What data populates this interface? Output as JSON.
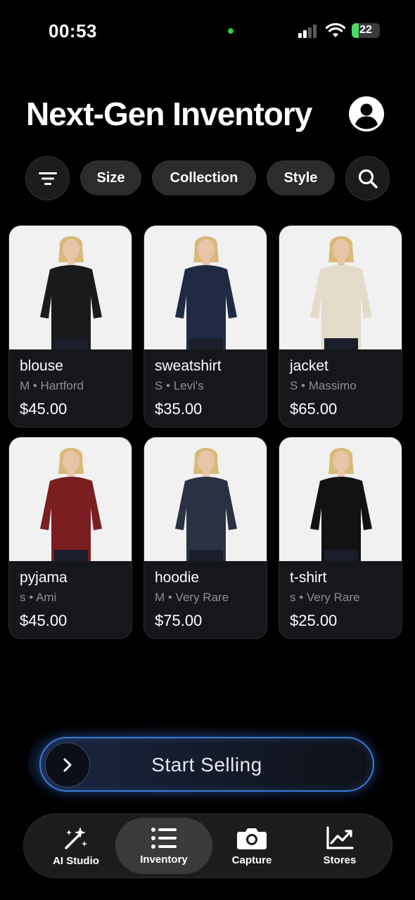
{
  "status": {
    "time": "00:53",
    "battery": "22"
  },
  "header": {
    "title": "Next-Gen Inventory"
  },
  "filters": [
    "Size",
    "Collection",
    "Style"
  ],
  "products": [
    {
      "name": "blouse",
      "meta": "M • Hartford",
      "price": "$45.00",
      "color": "#1a1a1a"
    },
    {
      "name": "sweatshirt",
      "meta": "S • Levi's",
      "price": "$35.00",
      "color": "#1f2a44"
    },
    {
      "name": "jacket",
      "meta": "S • Massimo",
      "price": "$65.00",
      "color": "#e3dccb"
    },
    {
      "name": "pyjama",
      "meta": "s • Ami",
      "price": "$45.00",
      "color": "#7a1e22"
    },
    {
      "name": "hoodie",
      "meta": "M • Very Rare",
      "price": "$75.00",
      "color": "#2a3142"
    },
    {
      "name": "t-shirt",
      "meta": "s • Very Rare",
      "price": "$25.00",
      "color": "#121212"
    }
  ],
  "sell": {
    "label": "Start Selling"
  },
  "tabs": [
    {
      "label": "AI Studio",
      "icon": "sparkle-wand-icon"
    },
    {
      "label": "Inventory",
      "icon": "list-icon"
    },
    {
      "label": "Capture",
      "icon": "camera-icon"
    },
    {
      "label": "Stores",
      "icon": "chart-icon"
    }
  ],
  "accent": "#3a7bd5"
}
